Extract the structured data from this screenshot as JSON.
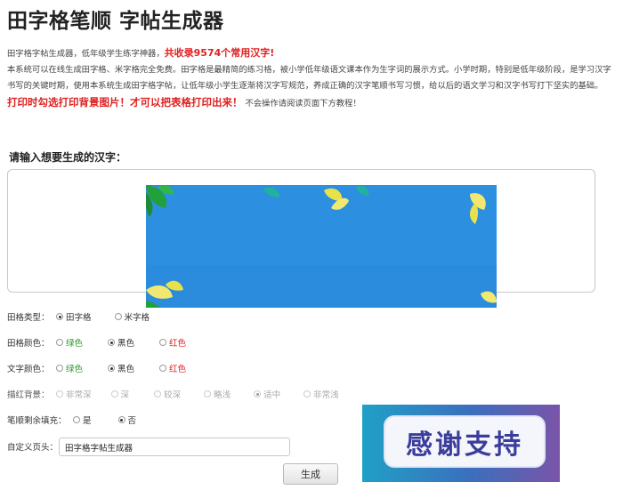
{
  "page": {
    "title": "田字格笔顺 字帖生成器"
  },
  "intro": {
    "line1_text": "田字格字帖生成器，低年级学生练字神器，",
    "line1_highlight": "共收录9574个常用汉字!",
    "paragraph": "本系统可以在线生成田字格、米字格完全免费。田字格是最精简的练习格，被小学低年级语文课本作为生字词的展示方式。小学时期，特别是低年级阶段，是学习汉字书写的关键时期，使用本系统生成田字格字帖，让低年级小学生逐渐将汉字写规范，养成正确的汉字笔顺书写习惯，给以后的语文学习和汉字书写打下坚实的基础。",
    "print_highlight": "打印时勾选打印背景图片！才可以把表格打印出来！",
    "print_note": "不会操作请阅读页面下方教程！"
  },
  "input": {
    "prompt": "请输入想要生成的汉字：",
    "value": ""
  },
  "options": {
    "grid_type": {
      "label": "田格类型：",
      "choices": [
        "田字格",
        "米字格"
      ],
      "selected": 0
    },
    "grid_color": {
      "label": "田格颜色：",
      "choices": [
        "绿色",
        "黑色",
        "红色"
      ],
      "selected": 1
    },
    "text_color": {
      "label": "文字颜色：",
      "choices": [
        "绿色",
        "黑色",
        "红色"
      ],
      "selected": 1
    },
    "trace_bg": {
      "label": "描红背景：",
      "choices": [
        "非常深",
        "深",
        "较深",
        "略浅",
        "适中",
        "非常浅"
      ],
      "selected": 4
    },
    "fill_remaining": {
      "label": "笔顺剩余填充：",
      "choices": [
        "是",
        "否"
      ],
      "selected": 1
    },
    "custom_header": {
      "label": "自定义页头：",
      "value": "田字格字帖生成器"
    }
  },
  "buttons": {
    "generate": "生成"
  },
  "thanks_banner": {
    "text": "感谢支持"
  },
  "colors": {
    "red": "#e02020",
    "green": "#2a9a2a",
    "banner_blue": "#2c8fe0"
  }
}
